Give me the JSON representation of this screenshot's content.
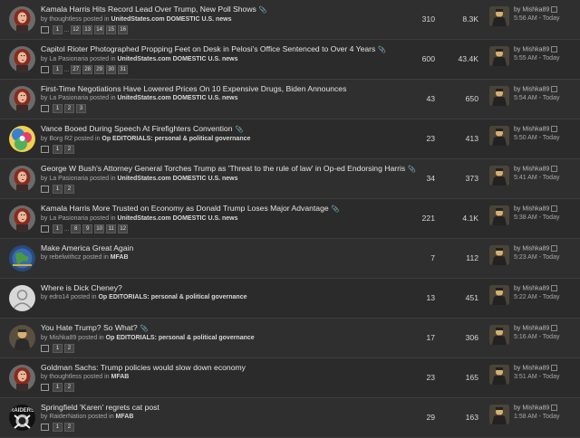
{
  "threads": [
    {
      "title": "Kamala Harris Hits Record Lead Over Trump, New Poll Shows",
      "clip": true,
      "by": "thoughtless",
      "forum": "UnitedStates.com DOMESTIC U.S. news",
      "pages": [
        "1",
        "...",
        "12",
        "13",
        "14",
        "15",
        "16"
      ],
      "replies": "310",
      "views": "8.3K",
      "last_by": "Mishka89",
      "last_time": "5:56 AM - Today",
      "avatar": "red-hair"
    },
    {
      "title": "Capitol Rioter Photographed Propping Feet on Desk in Pelosi's Office Sentenced to Over 4 Years",
      "clip": true,
      "by": "La Pasionaria",
      "forum": "UnitedStates.com DOMESTIC U.S. news",
      "pages": [
        "1",
        "...",
        "27",
        "28",
        "29",
        "30",
        "31"
      ],
      "replies": "600",
      "views": "43.4K",
      "last_by": "Mishka89",
      "last_time": "5:55 AM - Today",
      "avatar": "red-hair"
    },
    {
      "title": "First-Time Negotiations Have Lowered Prices On 10 Expensive Drugs, Biden Announces",
      "clip": false,
      "by": "La Pasionaria",
      "forum": "UnitedStates.com DOMESTIC U.S. news",
      "pages": [
        "1",
        "2",
        "3"
      ],
      "replies": "43",
      "views": "650",
      "last_by": "Mishka89",
      "last_time": "5:54 AM - Today",
      "avatar": "red-hair"
    },
    {
      "title": "Vance Booed During Speech At Firefighters Convention",
      "clip": true,
      "by": "Borg R2",
      "forum": "Op EDITORIALS: personal & political governance",
      "pages": [
        "1",
        "2"
      ],
      "replies": "23",
      "views": "413",
      "last_by": "Mishka89",
      "last_time": "5:50 AM - Today",
      "avatar": "colorful"
    },
    {
      "title": "George W Bush's Attorney General Torches Trump as 'Threat to the rule of law' in Op-ed Endorsing Harris",
      "clip": false,
      "clip2": true,
      "by": "La Pasionaria",
      "forum": "UnitedStates.com DOMESTIC U.S. news",
      "pages": [
        "1",
        "2"
      ],
      "replies": "34",
      "views": "373",
      "last_by": "Mishka89",
      "last_time": "5:41 AM - Today",
      "avatar": "red-hair"
    },
    {
      "title": "Kamala Harris More Trusted on Economy as Donald Trump Loses Major Advantage",
      "clip": true,
      "by": "La Pasionaria",
      "forum": "UnitedStates.com DOMESTIC U.S. news",
      "pages": [
        "1",
        "...",
        "8",
        "9",
        "10",
        "11",
        "12"
      ],
      "replies": "221",
      "views": "4.1K",
      "last_by": "Mishka89",
      "last_time": "5:38 AM - Today",
      "avatar": "red-hair"
    },
    {
      "title": "Make America Great Again",
      "clip": false,
      "by": "rebelwithcz",
      "forum": "MFAB",
      "pages": [],
      "replies": "7",
      "views": "112",
      "last_by": "Mishka89",
      "last_time": "5:23 AM - Today",
      "avatar": "globe"
    },
    {
      "title": "Where is Dick Cheney?",
      "clip": false,
      "by": "edro14",
      "forum": "Op EDITORIALS: personal & political governance",
      "pages": [],
      "replies": "13",
      "views": "451",
      "last_by": "Mishka89",
      "last_time": "5:22 AM - Today",
      "avatar": "blank"
    },
    {
      "title": "You Hate Trump? So What?",
      "clip": true,
      "by": "Mishka89",
      "forum": "Op EDITORIALS: personal & political governance",
      "pages": [
        "1",
        "2"
      ],
      "replies": "17",
      "views": "306",
      "last_by": "Mishka89",
      "last_time": "5:16 AM - Today",
      "avatar": "dark-figure"
    },
    {
      "title": "Goldman Sachs: Trump policies would slow down economy",
      "clip": false,
      "by": "thoughtless",
      "forum": "MFAB",
      "pages": [
        "1",
        "2"
      ],
      "replies": "23",
      "views": "165",
      "last_by": "Mishka89",
      "last_time": "3:51 AM - Today",
      "avatar": "red-hair"
    },
    {
      "title": "Springfield 'Karen' regrets cat post",
      "clip": false,
      "by": "RaiderNation",
      "forum": "MFAB",
      "pages": [
        "1",
        "2"
      ],
      "replies": "29",
      "views": "163",
      "last_by": "Mishka89",
      "last_time": "1:58 AM - Today",
      "avatar": "raiders"
    }
  ],
  "labels": {
    "by": "by",
    "posted_in": "posted in",
    "last_by_prefix": "by"
  },
  "colors": {
    "background": "#2d2d2d",
    "row_border": "#3e3e3e",
    "text": "#e4e4e4",
    "muted": "#a8a8a8"
  }
}
